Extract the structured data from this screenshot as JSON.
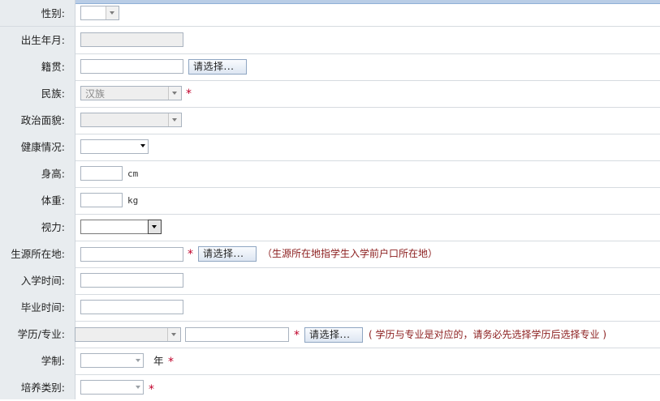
{
  "fields": {
    "gender": {
      "label": "性别:"
    },
    "birth": {
      "label": "出生年月:"
    },
    "native": {
      "label": "籍贯:",
      "button": "请选择..."
    },
    "ethnicity": {
      "label": "民族:",
      "value": "汉族",
      "required": "*"
    },
    "political": {
      "label": "政治面貌:"
    },
    "health": {
      "label": "健康情况:"
    },
    "height": {
      "label": "身高:",
      "unit": "cm"
    },
    "weight": {
      "label": "体重:",
      "unit": "kg"
    },
    "vision": {
      "label": "视力:"
    },
    "origin": {
      "label": "生源所在地:",
      "required": "*",
      "button": "请选择...",
      "note": "（生源所在地指学生入学前户口所在地）"
    },
    "enroll": {
      "label": "入学时间:"
    },
    "graduate": {
      "label": "毕业时间:"
    },
    "degree": {
      "label": "学历/专业:",
      "required": "*",
      "button": "请选择...",
      "note": "( 学历与专业是对应的，请务必先选择学历后选择专业 )"
    },
    "length": {
      "label": "学制:",
      "unit": "年",
      "required": "*"
    },
    "training": {
      "label": "培养类别:",
      "required": "*"
    }
  }
}
